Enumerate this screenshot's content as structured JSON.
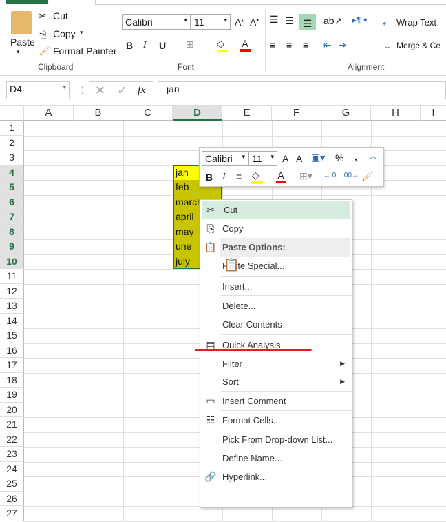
{
  "ribbon": {
    "clipboard": {
      "paste": "Paste",
      "cut": "Cut",
      "copy": "Copy",
      "format_painter": "Format Painter",
      "label": "Clipboard"
    },
    "font": {
      "name": "Calibri",
      "size": "11",
      "bold": "B",
      "italic": "I",
      "underline": "U",
      "label": "Font",
      "fill_color": "#ffff00",
      "font_color": "#ff0000"
    },
    "alignment": {
      "wrap_text": "Wrap Text",
      "merge": "Merge & Ce",
      "label": "Alignment"
    }
  },
  "formula_bar": {
    "name_box": "D4",
    "fx": "fx",
    "value": "jan"
  },
  "columns": [
    "A",
    "B",
    "C",
    "D",
    "E",
    "F",
    "G",
    "H",
    "I"
  ],
  "selected_column": "D",
  "rows": [
    "1",
    "2",
    "3",
    "4",
    "5",
    "6",
    "7",
    "8",
    "9",
    "10",
    "11",
    "12",
    "13",
    "14",
    "15",
    "16",
    "17",
    "18",
    "19",
    "20",
    "21",
    "22",
    "23",
    "24",
    "25",
    "26",
    "27"
  ],
  "cells_d": [
    "jan",
    "feb",
    "march",
    "april",
    "may",
    "une",
    "july"
  ],
  "mini_toolbar": {
    "font": "Calibri",
    "size": "11",
    "bold": "B",
    "italic": "I",
    "percent": "%",
    "comma": ","
  },
  "context_menu": {
    "items": [
      {
        "label": "Cut",
        "icon": "scissors-icon"
      },
      {
        "label": "Copy",
        "icon": "copy-icon"
      },
      {
        "label": "Paste Options:",
        "icon": "paste-icon"
      },
      {
        "label": "Paste Special..."
      },
      {
        "label": "Insert..."
      },
      {
        "label": "Delete..."
      },
      {
        "label": "Clear Contents"
      },
      {
        "label": "Quick Analysis",
        "icon": "quick-analysis-icon"
      },
      {
        "label": "Filter"
      },
      {
        "label": "Sort"
      },
      {
        "label": "Insert Comment",
        "icon": "comment-icon"
      },
      {
        "label": "Format Cells...",
        "icon": "format-cells-icon"
      },
      {
        "label": "Pick From Drop-down List..."
      },
      {
        "label": "Define Name..."
      },
      {
        "label": "Hyperlink...",
        "icon": "hyperlink-icon"
      }
    ]
  },
  "colors": {
    "accent": "#217346",
    "selection_fill": "#c8c400",
    "active_cell": "#ffff00",
    "hover": "#d5ecdf",
    "annotation": "#e02020"
  }
}
